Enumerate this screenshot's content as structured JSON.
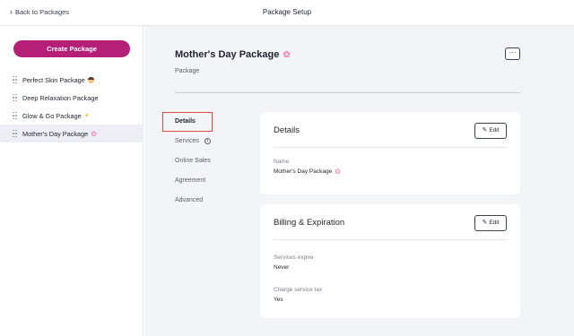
{
  "header": {
    "back_label": "Back to Packages",
    "title": "Package Setup"
  },
  "sidebar": {
    "create_label": "Create Package",
    "items": [
      {
        "label": "Perfect Skin Package",
        "emoji": "woman-face"
      },
      {
        "label": "Deep Relaxation Package",
        "emoji": ""
      },
      {
        "label": "Glow & Go Package",
        "emoji": "sparkles"
      },
      {
        "label": "Mother's Day Package",
        "emoji": "cherry-blossom",
        "active": true
      }
    ]
  },
  "package": {
    "title": "Mother's Day Package",
    "title_emoji": "🌸",
    "subtitle": "Package",
    "more_label": "···"
  },
  "subnav": {
    "items": [
      {
        "label": "Details",
        "active": true
      },
      {
        "label": "Services",
        "info": "i"
      },
      {
        "label": "Online Sales"
      },
      {
        "label": "Agreement"
      },
      {
        "label": "Advanced"
      }
    ]
  },
  "details_card": {
    "title": "Details",
    "edit_label": "Edit",
    "name_label": "Name",
    "name_value": "Mother's Day Package",
    "name_emoji": "🌸"
  },
  "billing_card": {
    "title": "Billing & Expiration",
    "edit_label": "Edit",
    "expire_label": "Services expire",
    "expire_value": "Never",
    "tax_label": "Charge service tax",
    "tax_value": "Yes"
  },
  "colors": {
    "brand": "#b51f77",
    "highlight": "#e04a3c",
    "background": "#f3f4f7"
  }
}
